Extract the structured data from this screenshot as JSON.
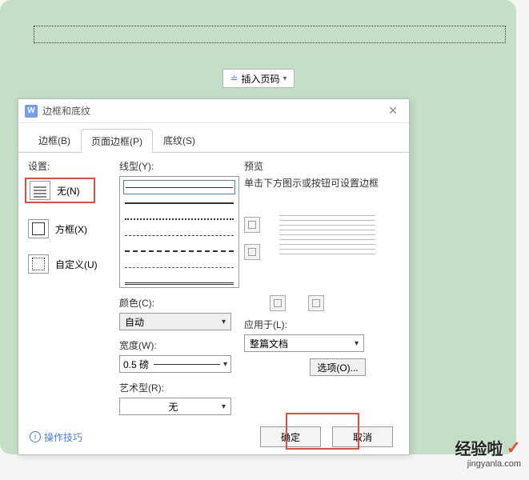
{
  "insert_page_btn": "插入页码",
  "dialog": {
    "title": "边框和底纹",
    "tabs": {
      "border": "边框(B)",
      "page_border": "页面边框(P)",
      "shading": "底纹(S)"
    },
    "settings": {
      "label": "设置:",
      "none": "无(N)",
      "box": "方框(X)",
      "custom": "自定义(U)"
    },
    "line_style_label": "线型(Y):",
    "color": {
      "label": "颜色(C):",
      "value": "自动"
    },
    "width": {
      "label": "宽度(W):",
      "value": "0.5  磅"
    },
    "art": {
      "label": "艺术型(R):",
      "value": "无"
    },
    "preview": {
      "label": "预览",
      "hint": "单击下方图示或按钮可设置边框"
    },
    "apply": {
      "label": "应用于(L):",
      "value": "整篇文档"
    },
    "options_btn": "选项(O)...",
    "tips_link": "操作技巧",
    "ok_btn": "确定",
    "cancel_btn": "取消"
  },
  "watermark": {
    "main": "经验啦",
    "sub": "jingyanla.com"
  }
}
